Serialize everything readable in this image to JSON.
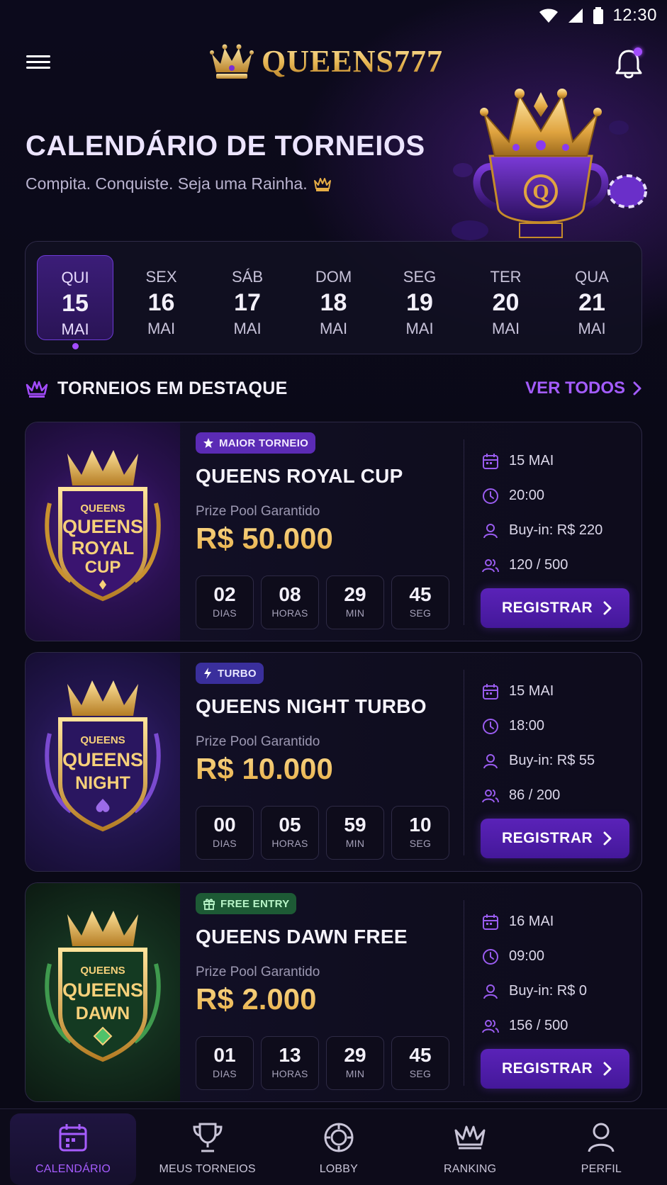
{
  "status_bar": {
    "time": "12:30",
    "icons": [
      "wifi-icon",
      "signal-icon",
      "battery-icon"
    ]
  },
  "header": {
    "brand": "QUEENS777",
    "brand_icon": "crown-icon",
    "has_notification": true
  },
  "hero": {
    "title": "CALENDÁRIO DE TORNEIOS",
    "subtitle": "Compita. Conquiste. Seja uma Rainha."
  },
  "dates": [
    {
      "weekday": "QUI",
      "day": "15",
      "month": "MAI",
      "active": true
    },
    {
      "weekday": "SEX",
      "day": "16",
      "month": "MAI",
      "active": false
    },
    {
      "weekday": "SÁB",
      "day": "17",
      "month": "MAI",
      "active": false
    },
    {
      "weekday": "DOM",
      "day": "18",
      "month": "MAI",
      "active": false
    },
    {
      "weekday": "SEG",
      "day": "19",
      "month": "MAI",
      "active": false
    },
    {
      "weekday": "TER",
      "day": "20",
      "month": "MAI",
      "active": false
    },
    {
      "weekday": "QUA",
      "day": "21",
      "month": "MAI",
      "active": false
    }
  ],
  "section": {
    "title": "TORNEIOS EM DESTAQUE",
    "view_all": "VER TODOS"
  },
  "tournaments": [
    {
      "badge": "MAIOR TORNEIO",
      "badge_icon": "star-icon",
      "theme": "purple",
      "emblem": [
        "QUEENS",
        "QUEENS",
        "ROYAL",
        "CUP"
      ],
      "title": "QUEENS ROYAL CUP",
      "prize_label": "Prize Pool Garantido",
      "prize": "R$ 50.000",
      "countdown": [
        {
          "value": "02",
          "unit": "DIAS"
        },
        {
          "value": "08",
          "unit": "HORAS"
        },
        {
          "value": "29",
          "unit": "MIN"
        },
        {
          "value": "45",
          "unit": "SEG"
        }
      ],
      "date": "15 MAI",
      "time": "20:00",
      "buyin": "Buy-in: R$ 220",
      "players": "120 / 500",
      "cta": "REGISTRAR"
    },
    {
      "badge": "TURBO",
      "badge_icon": "lightning-icon",
      "theme": "blue",
      "emblem": [
        "QUEENS",
        "QUEENS",
        "NIGHT"
      ],
      "title": "QUEENS NIGHT TURBO",
      "prize_label": "Prize Pool Garantido",
      "prize": "R$ 10.000",
      "countdown": [
        {
          "value": "00",
          "unit": "DIAS"
        },
        {
          "value": "05",
          "unit": "HORAS"
        },
        {
          "value": "59",
          "unit": "MIN"
        },
        {
          "value": "10",
          "unit": "SEG"
        }
      ],
      "date": "15 MAI",
      "time": "18:00",
      "buyin": "Buy-in: R$ 55",
      "players": "86 / 200",
      "cta": "REGISTRAR"
    },
    {
      "badge": "FREE ENTRY",
      "badge_icon": "gift-icon",
      "theme": "green",
      "emblem": [
        "QUEENS",
        "QUEENS",
        "DAWN"
      ],
      "title": "QUEENS DAWN FREE",
      "prize_label": "Prize Pool Garantido",
      "prize": "R$ 2.000",
      "countdown": [
        {
          "value": "01",
          "unit": "DIAS"
        },
        {
          "value": "13",
          "unit": "HORAS"
        },
        {
          "value": "29",
          "unit": "MIN"
        },
        {
          "value": "45",
          "unit": "SEG"
        }
      ],
      "date": "16 MAI",
      "time": "09:00",
      "buyin": "Buy-in: R$ 0",
      "players": "156 / 500",
      "cta": "REGISTRAR"
    }
  ],
  "bottom_nav": [
    {
      "label": "CALENDÁRIO",
      "icon": "calendar-icon",
      "active": true
    },
    {
      "label": "MEUS TORNEIOS",
      "icon": "trophy-icon",
      "active": false
    },
    {
      "label": "LOBBY",
      "icon": "poker-chip-icon",
      "active": false
    },
    {
      "label": "RANKING",
      "icon": "crown-icon",
      "active": false
    },
    {
      "label": "PERFIL",
      "icon": "user-icon",
      "active": false
    }
  ],
  "colors": {
    "accent": "#a34cff",
    "gold": "#e6ad45",
    "background": "#0b0a18"
  }
}
